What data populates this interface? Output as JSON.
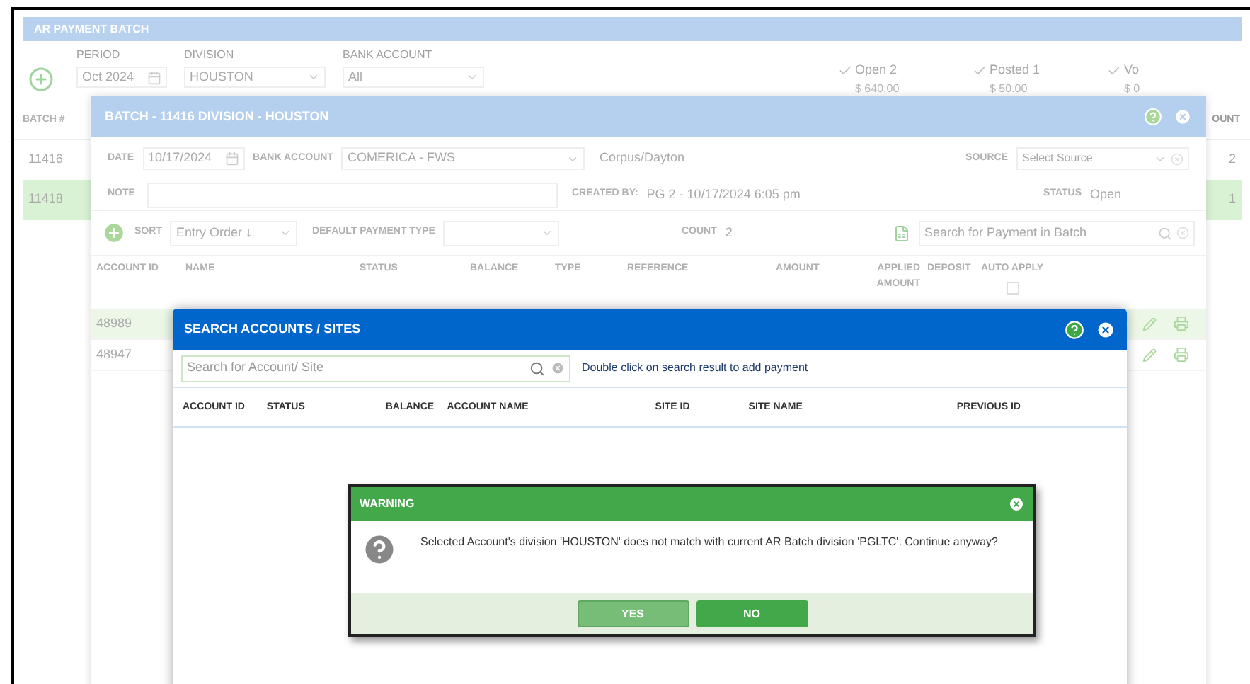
{
  "page": {
    "title": "AR PAYMENT BATCH",
    "filters": [
      {
        "label": "PERIOD",
        "value": "Oct 2024",
        "kind": "date"
      },
      {
        "label": "DIVISION",
        "value": "HOUSTON",
        "kind": "select"
      },
      {
        "label": "BANK ACCOUNT",
        "value": "All",
        "kind": "select"
      }
    ],
    "status_filters": [
      {
        "label": "Open 2",
        "amount": "$ 640.00",
        "checked": true
      },
      {
        "label": "Posted 1",
        "amount": "$ 50.00",
        "checked": true
      },
      {
        "label": "Vo",
        "amount": "$ 0",
        "checked": true
      }
    ],
    "columns": [
      "BATCH #",
      "OUNT"
    ],
    "rows": [
      {
        "batch": "11416",
        "count": "2",
        "selected": false
      },
      {
        "batch": "11418",
        "count": "1",
        "selected": true
      }
    ]
  },
  "batch_dialog": {
    "title": "BATCH - 11416 DIVISION - HOUSTON",
    "date_label": "DATE",
    "date": "10/17/2024",
    "bank_label": "BANK ACCOUNT",
    "bank": "COMERICA - FWS",
    "location": "Corpus/Dayton",
    "source_label": "SOURCE",
    "source_placeholder": "Select Source",
    "note_label": "NOTE",
    "created_label": "CREATED BY:",
    "created": "PG 2 - 10/17/2024 6:05 pm",
    "status_label": "STATUS",
    "status": "Open",
    "sort_label": "SORT",
    "sort": "Entry Order ↓",
    "payment_type_label": "DEFAULT PAYMENT TYPE",
    "count_label": "COUNT",
    "count": "2",
    "search_placeholder": "Search for Payment in Batch",
    "columns": [
      "ACCOUNT ID",
      "NAME",
      "STATUS",
      "BALANCE",
      "TYPE",
      "REFERENCE",
      "AMOUNT",
      "APPLIED AMOUNT",
      "DEPOSIT",
      "AUTO APPLY"
    ],
    "auto_apply_checked": false,
    "rows": [
      {
        "account_id": "48989",
        "selected": true
      },
      {
        "account_id": "48947",
        "selected": false
      }
    ]
  },
  "search_dialog": {
    "title": "SEARCH ACCOUNTS / SITES",
    "search_placeholder": "Search for Account/ Site",
    "hint": "Double click on search result to add payment",
    "columns": [
      "ACCOUNT ID",
      "STATUS",
      "BALANCE",
      "ACCOUNT NAME",
      "SITE ID",
      "SITE NAME",
      "PREVIOUS ID"
    ]
  },
  "warning": {
    "title": "WARNING",
    "message": "Selected Account's division 'HOUSTON' does not match with current AR Batch division 'PGLTC'. Continue anyway?",
    "buttons": [
      {
        "label": "YES",
        "selected": true
      },
      {
        "label": "NO",
        "selected": false
      }
    ]
  }
}
